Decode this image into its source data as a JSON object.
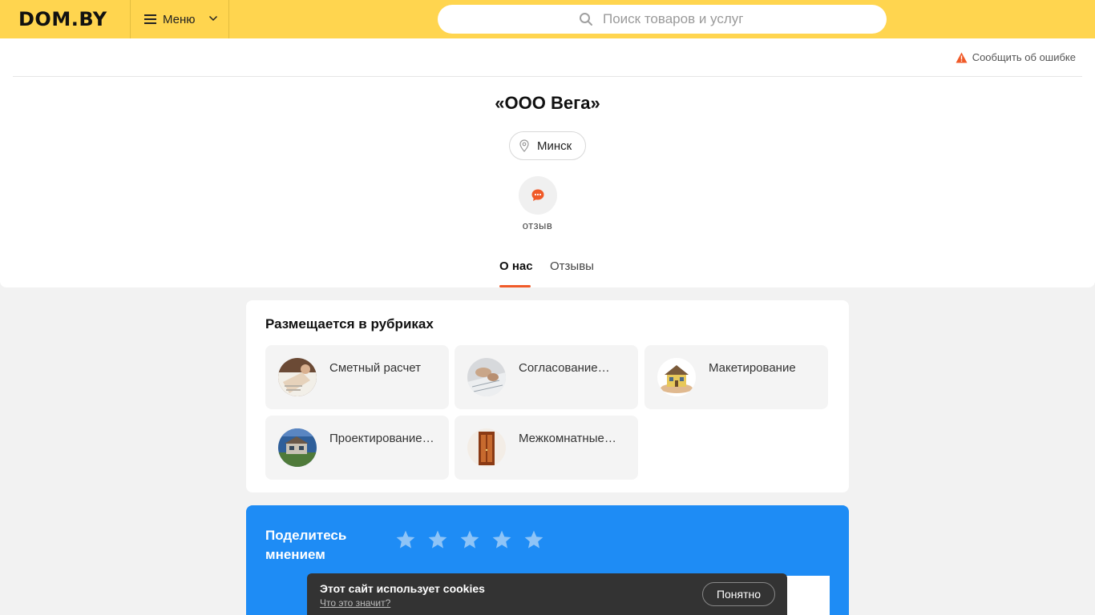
{
  "header": {
    "logo": "DOM.BY",
    "menu_label": "Меню",
    "search_placeholder": "Поиск товаров и услуг",
    "bg_color": "#ffd54f"
  },
  "company": {
    "report_label": "Сообщить об ошибке",
    "name": "«ООО Вега»",
    "city": "Минск",
    "review_label": "отзыв",
    "accent_color": "#f05a28"
  },
  "tabs": [
    {
      "label": "О нас",
      "active": true
    },
    {
      "label": "Отзывы",
      "active": false
    }
  ],
  "categories": {
    "title": "Размещается в рубриках",
    "items": [
      {
        "label": "Сметный расчет",
        "icon": "estimate-thumb"
      },
      {
        "label": "Согласование…",
        "icon": "approval-thumb"
      },
      {
        "label": "Макетирование",
        "icon": "house-model-thumb"
      },
      {
        "label": "Проектирование…",
        "icon": "house-design-thumb"
      },
      {
        "label": "Межкомнатные…",
        "icon": "interior-door-thumb"
      }
    ]
  },
  "opinion": {
    "title": "Поделитесь мнением",
    "rating": 0,
    "max_rating": 5,
    "bg_color": "#1e8cf5"
  },
  "cookie": {
    "message": "Этот сайт использует cookies",
    "link": "Что это значит?",
    "button": "Понятно"
  }
}
